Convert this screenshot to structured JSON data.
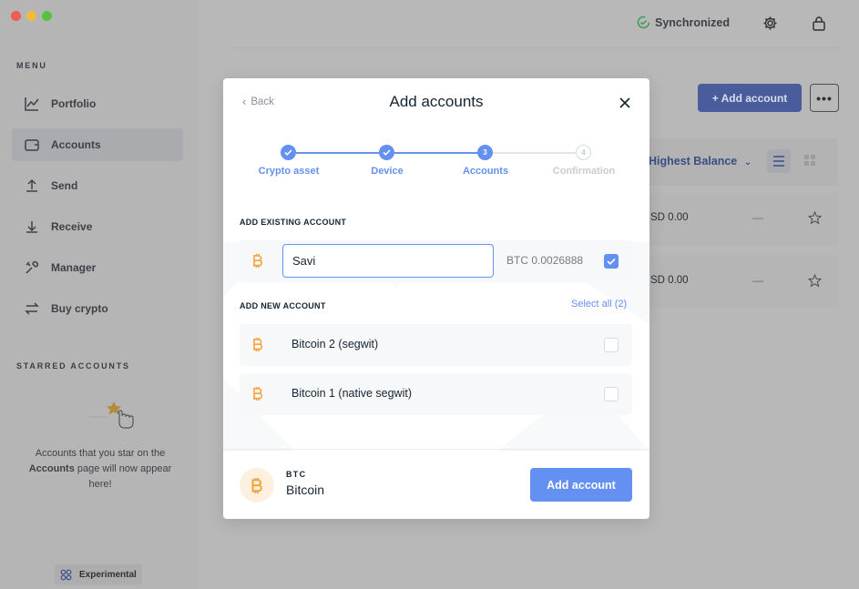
{
  "window": {
    "controls": [
      "close",
      "minimize",
      "zoom"
    ]
  },
  "sidebar": {
    "menu_title": "MENU",
    "items": [
      {
        "label": "Portfolio",
        "icon": "chart-icon",
        "active": false
      },
      {
        "label": "Accounts",
        "icon": "wallet-icon",
        "active": true
      },
      {
        "label": "Send",
        "icon": "send-icon",
        "active": false
      },
      {
        "label": "Receive",
        "icon": "receive-icon",
        "active": false
      },
      {
        "label": "Manager",
        "icon": "tools-icon",
        "active": false
      },
      {
        "label": "Buy crypto",
        "icon": "exchange-icon",
        "active": false
      }
    ],
    "starred_title": "STARRED ACCOUNTS",
    "starred_text_1": "Accounts that you star on the",
    "starred_text_bold": "Accounts",
    "starred_text_2": "page will now appear here!",
    "experimental_label": "Experimental"
  },
  "topbar": {
    "sync_status": "Synchronized",
    "sync_color": "#3a9b5a"
  },
  "background_page": {
    "add_account_label": "+ Add account",
    "more_label": "•••",
    "sort_label": "Highest Balance",
    "rows": [
      {
        "balance": "SD 0.00",
        "change": "—"
      },
      {
        "balance": "SD 0.00",
        "change": "—"
      }
    ]
  },
  "modal": {
    "back_label": "Back",
    "title": "Add accounts",
    "steps": [
      {
        "label": "Crypto asset",
        "state": "done"
      },
      {
        "label": "Device",
        "state": "done"
      },
      {
        "label": "Accounts",
        "state": "current",
        "number": "3"
      },
      {
        "label": "Confirmation",
        "state": "future",
        "number": "4"
      }
    ],
    "existing_section": "ADD EXISTING ACCOUNT",
    "existing_account": {
      "name_value": "Savi",
      "balance": "BTC 0.0026888",
      "checked": true
    },
    "new_section": "ADD NEW ACCOUNT",
    "select_all": "Select all (2)",
    "new_accounts": [
      {
        "name": "Bitcoin 2 (segwit)",
        "checked": false
      },
      {
        "name": "Bitcoin 1 (native segwit)",
        "checked": false
      }
    ],
    "footer": {
      "ticker": "BTC",
      "coin_name": "Bitcoin",
      "primary_button": "Add account"
    }
  },
  "colors": {
    "accent": "#6490f1",
    "bitcoin": "#f7a23b",
    "text": "#142533"
  }
}
